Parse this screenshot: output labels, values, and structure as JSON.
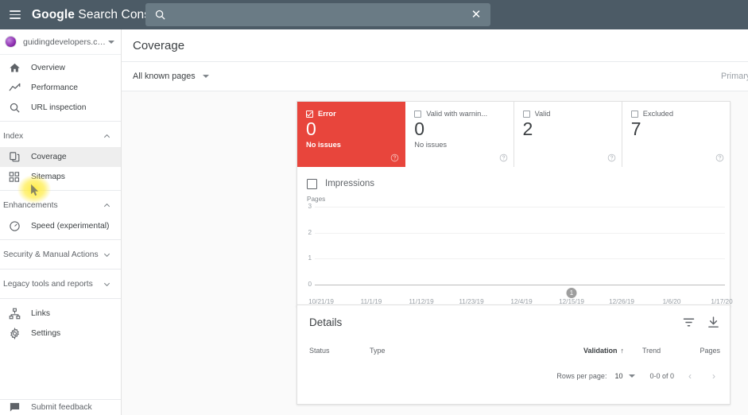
{
  "topbar": {
    "menu_icon": "hamburger-icon",
    "brand_bold": "Google",
    "brand_rest": " Search Console",
    "search": {
      "icon": "search-icon",
      "value": "",
      "placeholder": "",
      "clear_icon": "close-icon",
      "clear_glyph": "✕"
    }
  },
  "sidebar": {
    "property": {
      "name": "guidingdevelopers.com",
      "favicon": "site-favicon",
      "caret": "chevron-down-icon"
    },
    "items": [
      {
        "label": "Overview",
        "icon": "home-icon",
        "active": false
      },
      {
        "label": "Performance",
        "icon": "trending-up-icon",
        "active": false
      },
      {
        "label": "URL inspection",
        "icon": "search-icon",
        "active": false
      }
    ],
    "groups": [
      {
        "title": "Index",
        "expanded": true,
        "chevron": "chevron-up-icon",
        "items": [
          {
            "label": "Coverage",
            "icon": "pages-copy-icon",
            "active": true
          },
          {
            "label": "Sitemaps",
            "icon": "sitemap-icon",
            "active": false
          }
        ]
      },
      {
        "title": "Enhancements",
        "expanded": true,
        "chevron": "chevron-up-icon",
        "items": [
          {
            "label": "Speed (experimental)",
            "icon": "speed-gauge-icon",
            "active": false
          }
        ]
      },
      {
        "title": "Security & Manual Actions",
        "expanded": false,
        "chevron": "chevron-down-icon",
        "items": []
      },
      {
        "title": "Legacy tools and reports",
        "expanded": false,
        "chevron": "chevron-down-icon",
        "items": []
      }
    ],
    "bottom_items": [
      {
        "label": "Links",
        "icon": "links-network-icon"
      },
      {
        "label": "Settings",
        "icon": "gear-icon"
      }
    ],
    "feedback": {
      "label": "Submit feedback",
      "icon": "feedback-icon"
    }
  },
  "page": {
    "title": "Coverage",
    "filter": {
      "label": "All known pages",
      "caret": "chevron-down-icon"
    },
    "crawler_label": "Primary crawler"
  },
  "status_cards": [
    {
      "name": "Error",
      "value": "0",
      "sub": "No issues",
      "checked": true,
      "state": "error",
      "help": "help-icon"
    },
    {
      "name": "Valid with warnin...",
      "value": "0",
      "sub": "No issues",
      "checked": false,
      "state": "warning",
      "help": "help-icon"
    },
    {
      "name": "Valid",
      "value": "2",
      "sub": "",
      "checked": false,
      "state": "valid",
      "help": "help-icon"
    },
    {
      "name": "Excluded",
      "value": "7",
      "sub": "",
      "checked": false,
      "state": "excluded",
      "help": "help-icon"
    }
  ],
  "chart_legend": {
    "impressions_label": "Impressions",
    "impressions_checked": false
  },
  "chart_data": {
    "type": "line",
    "title": "",
    "xlabel": "",
    "ylabel": "Pages",
    "ylim": [
      0,
      3
    ],
    "yticks": [
      "0",
      "1",
      "2",
      "3"
    ],
    "grid": true,
    "legend": [
      "Impressions"
    ],
    "legend_position": "top-left",
    "categories": [
      "10/21/19",
      "11/1/19",
      "11/12/19",
      "11/23/19",
      "12/4/19",
      "12/15/19",
      "12/26/19",
      "1/6/20",
      "1/17/20"
    ],
    "series": [
      {
        "name": "Error",
        "values": [
          0,
          0,
          0,
          0,
          0,
          0,
          0,
          0,
          0
        ]
      }
    ],
    "annotations": [
      {
        "label": "1",
        "x": "12/15/19"
      }
    ]
  },
  "details": {
    "title": "Details",
    "filter_icon": "filter-icon",
    "download_icon": "download-icon",
    "columns": [
      "Status",
      "Type",
      "Validation",
      "Trend",
      "Pages"
    ],
    "sort_column": "Validation",
    "sort_arrow": "↑",
    "rows": [],
    "footer": {
      "rows_per_page_label": "Rows per page:",
      "rows_per_page_value": "10",
      "rows_per_page_caret": "chevron-down-icon",
      "range_text": "0-0 of 0",
      "prev_icon": "chevron-left-icon",
      "prev_glyph": "‹",
      "next_icon": "chevron-right-icon",
      "next_glyph": "›"
    }
  },
  "colors": {
    "header_bg": "#4c5b66",
    "search_bg": "#6a7b85",
    "error_red": "#e8453c",
    "canvas": "#fafafa",
    "text_primary": "#3c4043",
    "text_secondary": "#5f6368",
    "cursor_highlight": "#ffeb3b"
  }
}
